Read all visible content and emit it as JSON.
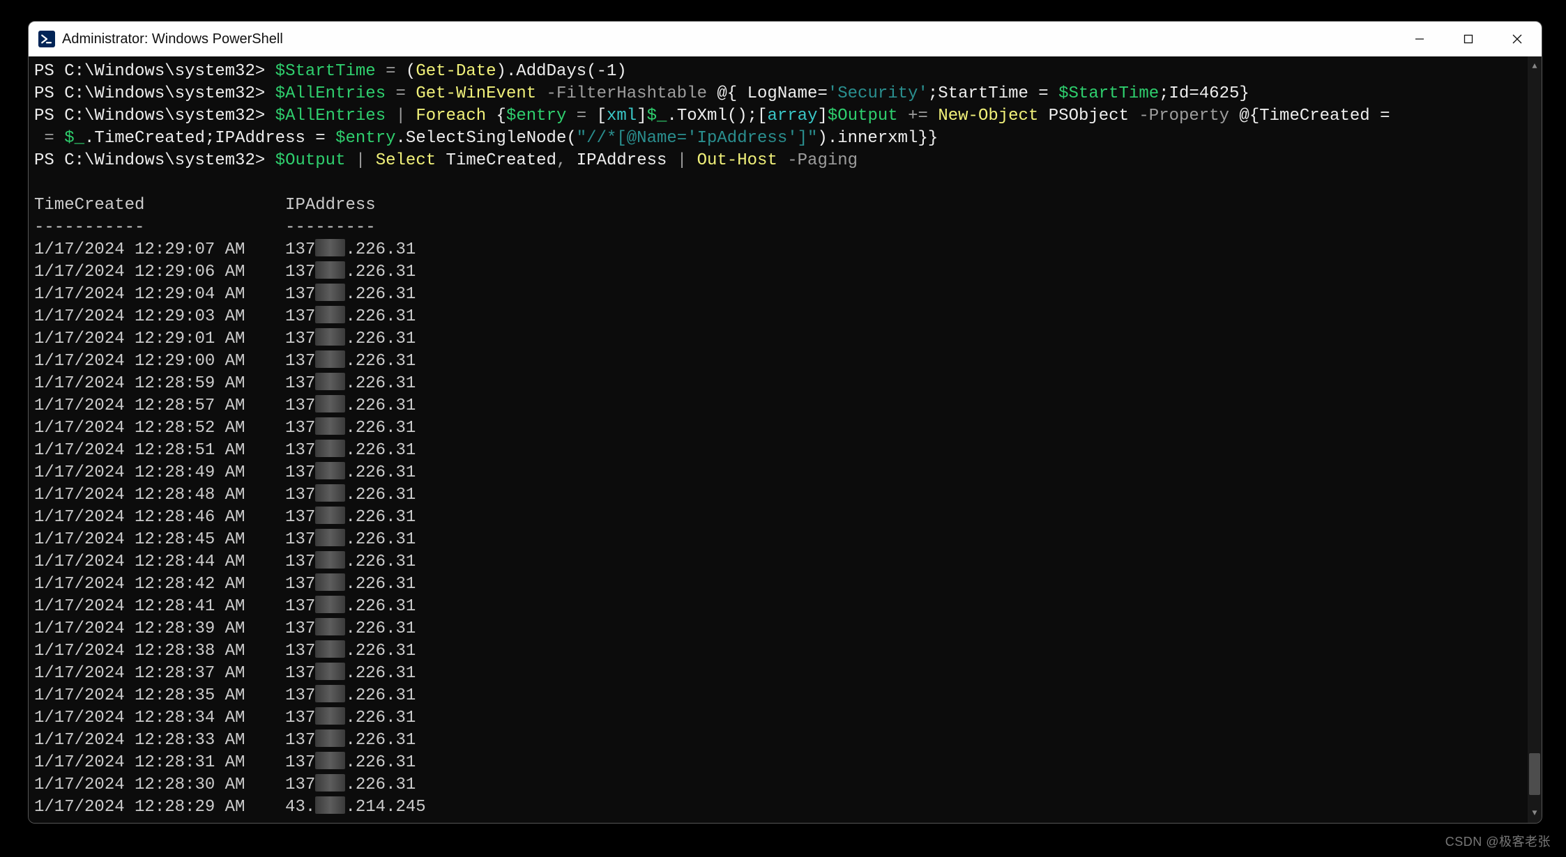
{
  "window": {
    "title": "Administrator: Windows PowerShell"
  },
  "prompt": "PS C:\\Windows\\system32>",
  "commands": {
    "line1": {
      "var1": "$StartTime",
      "eq": " = ",
      "lp": "(",
      "cmd": "Get-Date",
      "rp": ")",
      "method": ".AddDays(",
      "arg": "-1",
      "close": ")"
    },
    "line2": {
      "var1": "$AllEntries",
      "eq": " = ",
      "cmd": "Get-WinEvent",
      "flag": " -FilterHashtable ",
      "hash_open": "@{ ",
      "k1": "LogName=",
      "v1": "'Security'",
      "sep1": ";",
      "k2": "StartTime = ",
      "v2": "$StartTime",
      "sep2": ";",
      "k3": "Id=",
      "v3": "4625",
      "hash_close": "}"
    },
    "line3": {
      "var1": "$AllEntries",
      "pipe": " | ",
      "foreach": "Foreach ",
      "lb": "{",
      "ev": "$entry",
      "eq": " = ",
      "lbr": "[",
      "xml": "xml",
      "rbr": "]",
      "dollar": "$_",
      "toxml": ".ToXml();",
      "lbr2": "[",
      "array": "array",
      "rbr2": "]",
      "outv": "$Output",
      "plus": " += ",
      "newobj": "New-Object",
      "pso": " PSObject ",
      "propflag": "-Property ",
      "hash": "@{",
      "tcprop": "TimeCreated = ",
      "dollar2": "$_",
      "dot_tc": ".TimeCreated;",
      "ipprop": "IPAddress = ",
      "ev2": "$entry",
      "sel": ".SelectSingleNode(",
      "xpath": "\"//*[@Name='IpAddress']\"",
      "selclose": ").innerxml}}"
    },
    "line4": {
      "var1": "$Output",
      "pipe1": " | ",
      "select": "Select",
      "cols": " TimeCreated",
      "comma": ",",
      "col2": " IPAddress ",
      "pipe2": "| ",
      "outhost": "Out-Host",
      "paging": " -Paging"
    }
  },
  "headers": {
    "h1": "TimeCreated",
    "h2": "IPAddress",
    "dash1": "-----------",
    "dash2": "---------"
  },
  "rows": [
    {
      "time": "1/17/2024 12:29:07 AM",
      "ip_a": "137",
      "ip_b": ".226.31"
    },
    {
      "time": "1/17/2024 12:29:06 AM",
      "ip_a": "137",
      "ip_b": ".226.31"
    },
    {
      "time": "1/17/2024 12:29:04 AM",
      "ip_a": "137",
      "ip_b": ".226.31"
    },
    {
      "time": "1/17/2024 12:29:03 AM",
      "ip_a": "137",
      "ip_b": ".226.31"
    },
    {
      "time": "1/17/2024 12:29:01 AM",
      "ip_a": "137",
      "ip_b": ".226.31"
    },
    {
      "time": "1/17/2024 12:29:00 AM",
      "ip_a": "137",
      "ip_b": ".226.31"
    },
    {
      "time": "1/17/2024 12:28:59 AM",
      "ip_a": "137",
      "ip_b": ".226.31"
    },
    {
      "time": "1/17/2024 12:28:57 AM",
      "ip_a": "137",
      "ip_b": ".226.31"
    },
    {
      "time": "1/17/2024 12:28:52 AM",
      "ip_a": "137",
      "ip_b": ".226.31"
    },
    {
      "time": "1/17/2024 12:28:51 AM",
      "ip_a": "137",
      "ip_b": ".226.31"
    },
    {
      "time": "1/17/2024 12:28:49 AM",
      "ip_a": "137",
      "ip_b": ".226.31"
    },
    {
      "time": "1/17/2024 12:28:48 AM",
      "ip_a": "137",
      "ip_b": ".226.31"
    },
    {
      "time": "1/17/2024 12:28:46 AM",
      "ip_a": "137",
      "ip_b": ".226.31"
    },
    {
      "time": "1/17/2024 12:28:45 AM",
      "ip_a": "137",
      "ip_b": ".226.31"
    },
    {
      "time": "1/17/2024 12:28:44 AM",
      "ip_a": "137",
      "ip_b": ".226.31"
    },
    {
      "time": "1/17/2024 12:28:42 AM",
      "ip_a": "137",
      "ip_b": ".226.31"
    },
    {
      "time": "1/17/2024 12:28:41 AM",
      "ip_a": "137",
      "ip_b": ".226.31"
    },
    {
      "time": "1/17/2024 12:28:39 AM",
      "ip_a": "137",
      "ip_b": ".226.31"
    },
    {
      "time": "1/17/2024 12:28:38 AM",
      "ip_a": "137",
      "ip_b": ".226.31"
    },
    {
      "time": "1/17/2024 12:28:37 AM",
      "ip_a": "137",
      "ip_b": ".226.31"
    },
    {
      "time": "1/17/2024 12:28:35 AM",
      "ip_a": "137",
      "ip_b": ".226.31"
    },
    {
      "time": "1/17/2024 12:28:34 AM",
      "ip_a": "137",
      "ip_b": ".226.31"
    },
    {
      "time": "1/17/2024 12:28:33 AM",
      "ip_a": "137",
      "ip_b": ".226.31"
    },
    {
      "time": "1/17/2024 12:28:31 AM",
      "ip_a": "137",
      "ip_b": ".226.31"
    },
    {
      "time": "1/17/2024 12:28:30 AM",
      "ip_a": "137",
      "ip_b": ".226.31"
    },
    {
      "time": "1/17/2024 12:28:29 AM",
      "ip_a": "43.",
      "ip_b": ".214.245"
    }
  ],
  "watermark": "CSDN @极客老张"
}
